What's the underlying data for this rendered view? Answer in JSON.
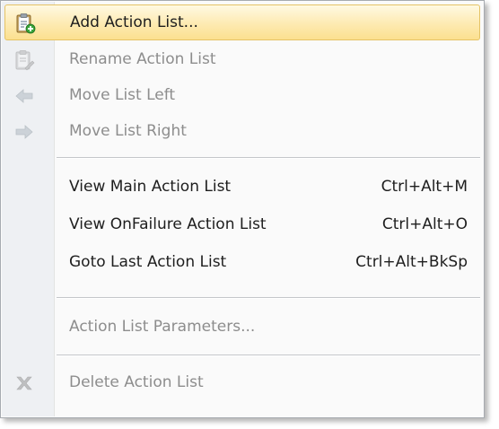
{
  "menu": {
    "items": [
      {
        "label": "Add Action List...",
        "icon": "clipboard-add-icon",
        "enabled": true,
        "highlighted": true
      },
      {
        "label": "Rename Action List",
        "icon": "clipboard-rename-icon",
        "enabled": false
      },
      {
        "label": "Move List Left",
        "icon": "arrow-left-icon",
        "enabled": false
      },
      {
        "label": "Move List Right",
        "icon": "arrow-right-icon",
        "enabled": false
      },
      {
        "label": "View Main Action List",
        "shortcut": "Ctrl+Alt+M",
        "enabled": true
      },
      {
        "label": "View OnFailure Action List",
        "shortcut": "Ctrl+Alt+O",
        "enabled": true
      },
      {
        "label": "Goto Last Action List",
        "shortcut": "Ctrl+Alt+BkSp",
        "enabled": true
      },
      {
        "label": "Action List Parameters...",
        "enabled": false
      },
      {
        "label": "Delete Action List",
        "icon": "delete-x-icon",
        "enabled": false
      }
    ]
  },
  "colors": {
    "highlight": "#fce08f",
    "disabled_text": "#8d8d8d",
    "enabled_text": "#1e1e1e"
  }
}
